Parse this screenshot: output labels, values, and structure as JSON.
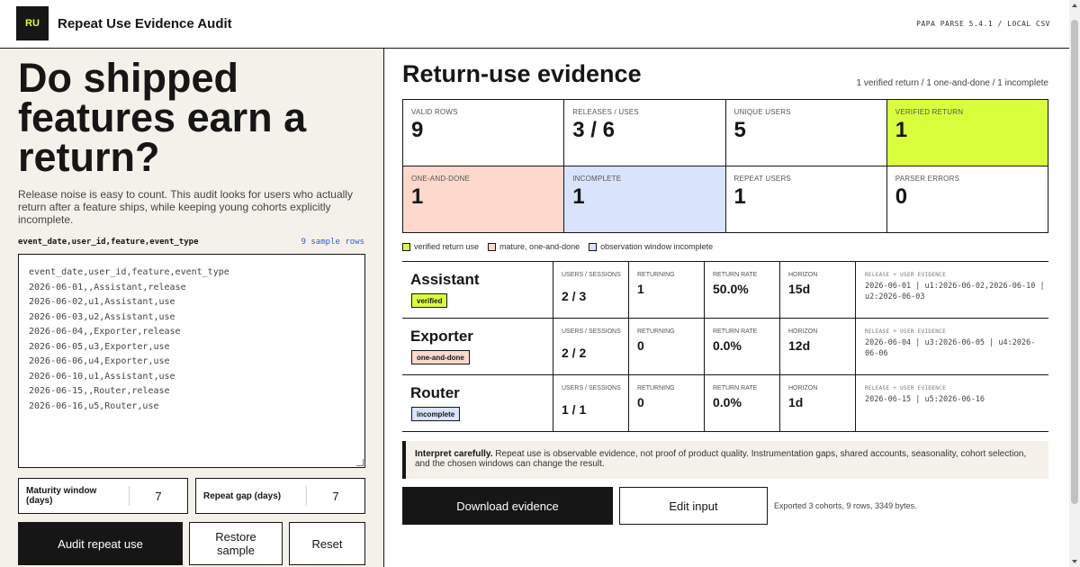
{
  "header": {
    "logo_text": "RU",
    "title": "Repeat Use Evidence Audit",
    "parser_version": "PAPA PARSE 5.4.1 / LOCAL CSV"
  },
  "left": {
    "headline": "Do shipped features earn a return?",
    "intro": "Release noise is easy to count. This audit looks for users who actually return after a feature ships, while keeping young cohorts explicitly incomplete.",
    "csv_label": "event_date,user_id,feature,event_type",
    "sample_rows_label": "9 sample rows",
    "csv_text": "event_date,user_id,feature,event_type\n2026-06-01,,Assistant,release\n2026-06-02,u1,Assistant,use\n2026-06-03,u2,Assistant,use\n2026-06-04,,Exporter,release\n2026-06-05,u3,Exporter,use\n2026-06-06,u4,Exporter,use\n2026-06-10,u1,Assistant,use\n2026-06-15,,Router,release\n2026-06-16,u5,Router,use",
    "maturity_label": "Maturity window (days)",
    "maturity_value": "7",
    "repeat_gap_label": "Repeat gap (days)",
    "repeat_gap_value": "7",
    "audit_button": "Audit repeat use",
    "restore_button": "Restore sample",
    "reset_button": "Reset"
  },
  "right": {
    "title": "Return-use evidence",
    "summary": "1 verified return / 1 one-and-done / 1 incomplete",
    "kpis": [
      {
        "label": "VALID ROWS",
        "value": "9",
        "color": "#ffffff"
      },
      {
        "label": "RELEASES / USES",
        "value": "3 / 6",
        "color": "#ffffff"
      },
      {
        "label": "UNIQUE USERS",
        "value": "5",
        "color": "#ffffff"
      },
      {
        "label": "VERIFIED RETURN",
        "value": "1",
        "color": "#d9ff3c"
      },
      {
        "label": "ONE-AND-DONE",
        "value": "1",
        "color": "#fdd8cc"
      },
      {
        "label": "INCOMPLETE",
        "value": "1",
        "color": "#d9e3fb"
      },
      {
        "label": "REPEAT USERS",
        "value": "1",
        "color": "#ffffff"
      },
      {
        "label": "PARSER ERRORS",
        "value": "0",
        "color": "#ffffff"
      }
    ],
    "legend": [
      {
        "label": "verified return use",
        "color": "#d9ff3c"
      },
      {
        "label": "mature, one-and-done",
        "color": "#fdd8cc"
      },
      {
        "label": "observation window incomplete",
        "color": "#d9e3fb"
      }
    ],
    "metric_labels": {
      "users": "USERS / SESSIONS",
      "returning": "RETURNING",
      "rate": "RETURN RATE",
      "horizon": "HORIZON",
      "evidence": "RELEASE + USER EVIDENCE"
    },
    "cohorts": [
      {
        "name": "Assistant",
        "badge": "verified",
        "badge_color": "#d9ff3c",
        "users": "2 / 3",
        "returning": "1",
        "rate": "50.0%",
        "horizon": "15d",
        "evidence": "2026-06-01 | u1:2026-06-02,2026-06-10 | u2:2026-06-03"
      },
      {
        "name": "Exporter",
        "badge": "one-and-done",
        "badge_color": "#fdd8cc",
        "users": "2 / 2",
        "returning": "0",
        "rate": "0.0%",
        "horizon": "12d",
        "evidence": "2026-06-04 | u3:2026-06-05 | u4:2026-06-06"
      },
      {
        "name": "Router",
        "badge": "incomplete",
        "badge_color": "#d9e3fb",
        "users": "1 / 1",
        "returning": "0",
        "rate": "0.0%",
        "horizon": "1d",
        "evidence": "2026-06-15 | u5:2026-06-16"
      }
    ],
    "callout_bold": "Interpret carefully.",
    "callout_text": "Repeat use is observable evidence, not proof of product quality. Instrumentation gaps, shared accounts, seasonality, cohort selection, and the chosen windows can change the result.",
    "download_button": "Download evidence",
    "edit_button": "Edit input",
    "export_note": "Exported 3 cohorts, 9 rows, 3349 bytes."
  }
}
